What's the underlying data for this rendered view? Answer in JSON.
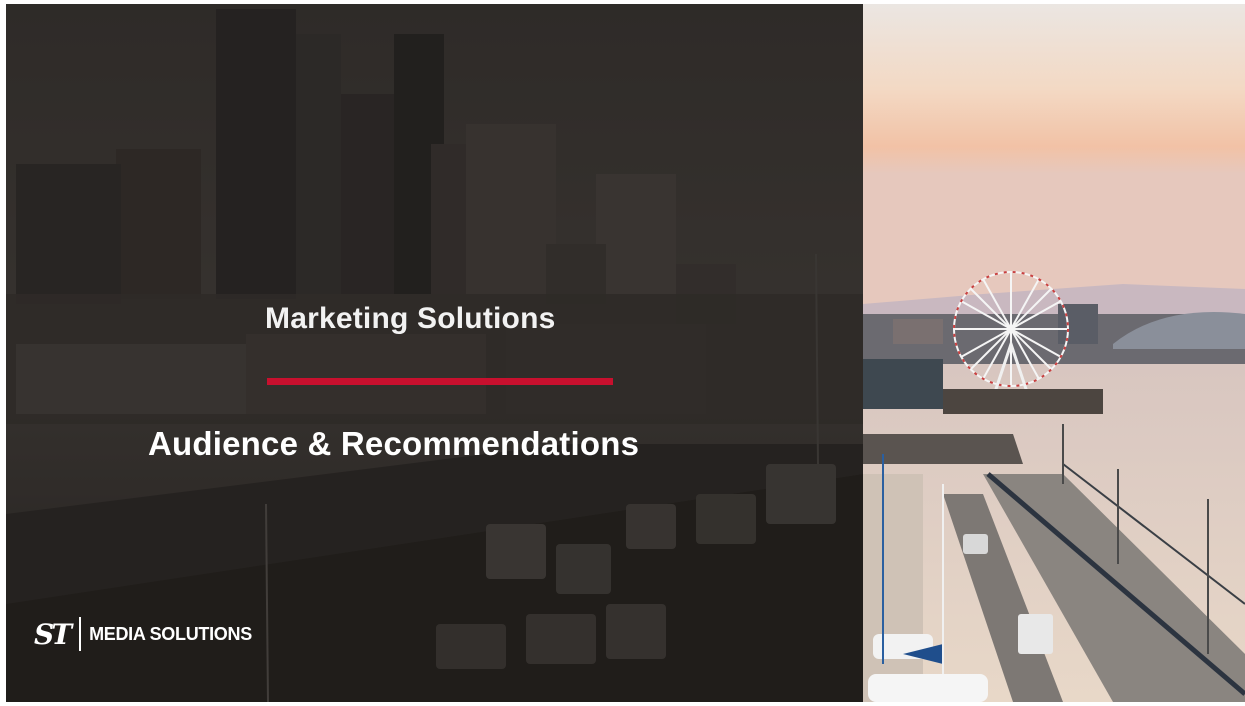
{
  "slide": {
    "title": "Marketing Solutions",
    "subtitle": "Audience & Recommendations",
    "accent_color": "#c8102e",
    "logo": {
      "mark": "ST",
      "text": "MEDIA SOLUTIONS"
    },
    "background_left": "Seattle waterfront cityscape photo (darkened)",
    "background_right": "Seattle waterfront with Great Wheel at sunset photo"
  }
}
